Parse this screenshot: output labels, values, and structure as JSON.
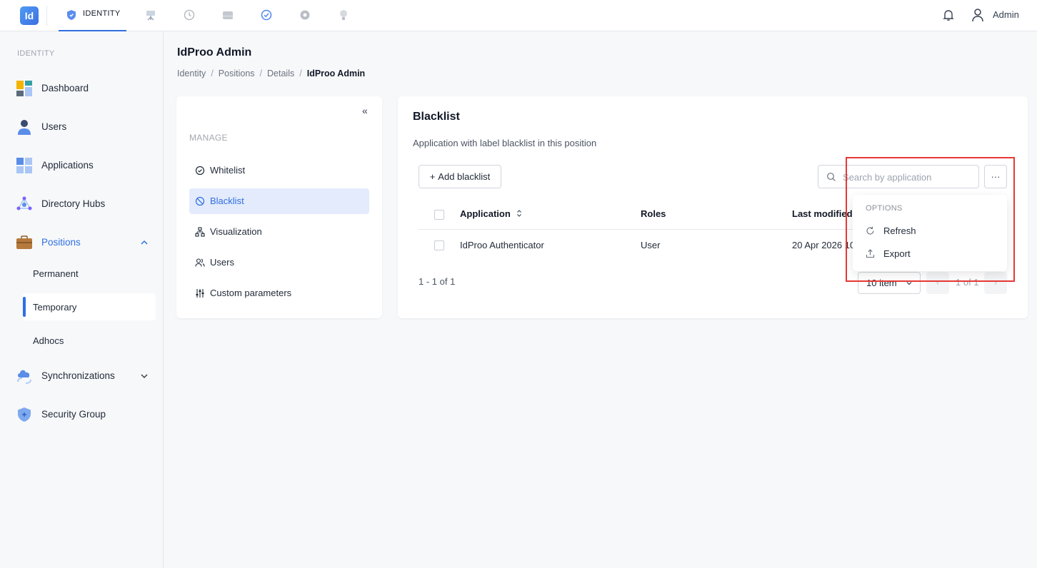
{
  "topbar": {
    "logo_text": "Id",
    "active_tab": "IDENTITY",
    "tab_icons": [
      "shield-icon",
      "presentation-icon",
      "history-icon",
      "storage-icon",
      "check-circle-icon",
      "gear-icon",
      "bulb-icon"
    ],
    "user_name": "Admin"
  },
  "sidebar": {
    "section": "IDENTITY",
    "items": [
      {
        "label": "Dashboard",
        "icon": "dashboard-icon"
      },
      {
        "label": "Users",
        "icon": "user-icon"
      },
      {
        "label": "Applications",
        "icon": "applications-icon"
      },
      {
        "label": "Directory Hubs",
        "icon": "hub-icon"
      },
      {
        "label": "Positions",
        "icon": "briefcase-icon",
        "expanded": true
      },
      {
        "label": "Synchronizations",
        "icon": "cloud-sync-icon",
        "expanded": false
      },
      {
        "label": "Security Group",
        "icon": "shield-icon"
      }
    ],
    "positions_sub": [
      "Permanent",
      "Temporary",
      "Adhocs"
    ],
    "selected_sub": "Temporary"
  },
  "header": {
    "title": "IdProo Admin",
    "breadcrumb": [
      "Identity",
      "Positions",
      "Details",
      "IdProo Admin"
    ]
  },
  "manage": {
    "collapse_label": "«",
    "title": "MANAGE",
    "items": [
      {
        "label": "Whitelist",
        "icon": "check-circle-icon"
      },
      {
        "label": "Blacklist",
        "icon": "ban-icon"
      },
      {
        "label": "Visualization",
        "icon": "hierarchy-icon"
      },
      {
        "label": "Users",
        "icon": "users-icon"
      },
      {
        "label": "Custom parameters",
        "icon": "sliders-icon"
      }
    ],
    "active": "Blacklist"
  },
  "blacklist": {
    "title": "Blacklist",
    "description": "Application with label blacklist in this position",
    "add_label": "Add blacklist",
    "add_icon_glyph": "+",
    "search_placeholder": "Search by application",
    "more_label": "···",
    "columns": [
      "Application",
      "Roles",
      "Last modified"
    ],
    "rows": [
      {
        "application": "IdProo Authenticator",
        "roles": "User",
        "last_modified": "20 Apr 2026 10"
      }
    ],
    "range": "1 - 1 of 1",
    "per_page": "10 item",
    "page_info": "1 of 1",
    "prev_label": "‹",
    "next_label": "›"
  },
  "options_menu": {
    "title": "OPTIONS",
    "items": [
      {
        "label": "Refresh",
        "icon": "refresh-icon"
      },
      {
        "label": "Export",
        "icon": "export-icon"
      }
    ]
  },
  "colors": {
    "accent": "#2f6fe3",
    "highlight": "#e53935",
    "active_bg": "#e4ebfc"
  }
}
